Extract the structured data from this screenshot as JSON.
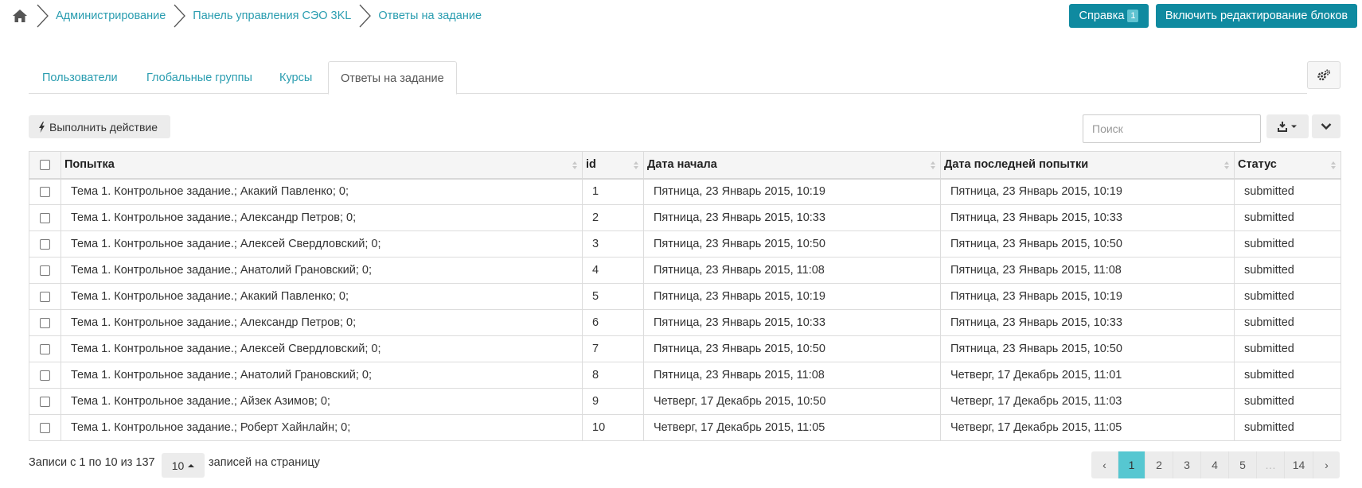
{
  "breadcrumb": {
    "home_icon": "home-icon",
    "items": [
      "Администрирование",
      "Панель управления СЭО 3KL",
      "Ответы на задание"
    ]
  },
  "header": {
    "help_label": "Справка",
    "help_badge": "1",
    "edit_blocks_label": "Включить редактирование блоков"
  },
  "tabs": [
    {
      "label": "Пользователи",
      "active": false
    },
    {
      "label": "Глобальные группы",
      "active": false
    },
    {
      "label": "Курсы",
      "active": false
    },
    {
      "label": "Ответы на задание",
      "active": true
    }
  ],
  "toolbar": {
    "action_label": "Выполнить действие",
    "search_placeholder": "Поиск",
    "export_icon": "download-icon",
    "collapse_icon": "chevron-down-icon"
  },
  "table": {
    "columns": [
      "Попытка",
      "id",
      "Дата начала",
      "Дата последней попытки",
      "Статус"
    ],
    "rows": [
      {
        "attempt": "Тема 1. Контрольное задание.; Акакий Павленко; 0;",
        "id": "1",
        "start": "Пятница, 23 Январь 2015, 10:19",
        "last": "Пятница, 23 Январь 2015, 10:19",
        "status": "submitted"
      },
      {
        "attempt": "Тема 1. Контрольное задание.; Александр Петров; 0;",
        "id": "2",
        "start": "Пятница, 23 Январь 2015, 10:33",
        "last": "Пятница, 23 Январь 2015, 10:33",
        "status": "submitted"
      },
      {
        "attempt": "Тема 1. Контрольное задание.; Алексей Свердловский; 0;",
        "id": "3",
        "start": "Пятница, 23 Январь 2015, 10:50",
        "last": "Пятница, 23 Январь 2015, 10:50",
        "status": "submitted"
      },
      {
        "attempt": "Тема 1. Контрольное задание.; Анатолий Грановский; 0;",
        "id": "4",
        "start": "Пятница, 23 Январь 2015, 11:08",
        "last": "Пятница, 23 Январь 2015, 11:08",
        "status": "submitted"
      },
      {
        "attempt": "Тема 1. Контрольное задание.; Акакий Павленко; 0;",
        "id": "5",
        "start": "Пятница, 23 Январь 2015, 10:19",
        "last": "Пятница, 23 Январь 2015, 10:19",
        "status": "submitted"
      },
      {
        "attempt": "Тема 1. Контрольное задание.; Александр Петров; 0;",
        "id": "6",
        "start": "Пятница, 23 Январь 2015, 10:33",
        "last": "Пятница, 23 Январь 2015, 10:33",
        "status": "submitted"
      },
      {
        "attempt": "Тема 1. Контрольное задание.; Алексей Свердловский; 0;",
        "id": "7",
        "start": "Пятница, 23 Январь 2015, 10:50",
        "last": "Пятница, 23 Январь 2015, 10:50",
        "status": "submitted"
      },
      {
        "attempt": "Тема 1. Контрольное задание.; Анатолий Грановский; 0;",
        "id": "8",
        "start": "Пятница, 23 Январь 2015, 11:08",
        "last": "Четверг, 17 Декабрь 2015, 11:01",
        "status": "submitted"
      },
      {
        "attempt": "Тема 1. Контрольное задание.; Айзек Азимов; 0;",
        "id": "9",
        "start": "Четверг, 17 Декабрь 2015, 10:50",
        "last": "Четверг, 17 Декабрь 2015, 11:03",
        "status": "submitted"
      },
      {
        "attempt": "Тема 1. Контрольное задание.; Роберт Хайнлайн; 0;",
        "id": "10",
        "start": "Четверг, 17 Декабрь 2015, 11:05",
        "last": "Четверг, 17 Декабрь 2015, 11:05",
        "status": "submitted"
      }
    ]
  },
  "footer": {
    "info": "Записи с 1 по 10 из 137",
    "page_length": "10",
    "page_length_label": "записей на страницу",
    "pages": [
      "‹",
      "1",
      "2",
      "3",
      "4",
      "5",
      "…",
      "14",
      "›"
    ],
    "active_page": "1"
  },
  "colors": {
    "accent": "#0f8aa0",
    "link": "#2a9db0",
    "active_page": "#56c7d1"
  }
}
